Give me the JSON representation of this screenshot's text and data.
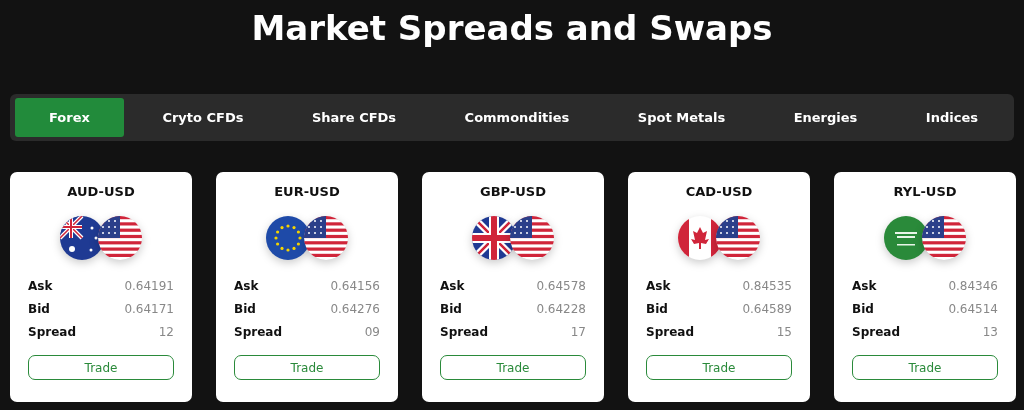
{
  "title": "Market Spreads and Swaps",
  "tabs": [
    {
      "label": "Forex",
      "selected": true
    },
    {
      "label": "Cryto CFDs",
      "selected": false
    },
    {
      "label": "Share CFDs",
      "selected": false
    },
    {
      "label": "Commondities",
      "selected": false
    },
    {
      "label": "Spot Metals",
      "selected": false
    },
    {
      "label": "Energies",
      "selected": false
    },
    {
      "label": "Indices",
      "selected": false
    }
  ],
  "cards": [
    {
      "pair": "AUD-USD",
      "rows": [
        {
          "label": "Ask",
          "value": "0.64191"
        },
        {
          "label": "Bid",
          "value": "0.64171"
        },
        {
          "label": "Spread",
          "value": "12"
        }
      ],
      "button": "Trade"
    },
    {
      "pair": "EUR-USD",
      "rows": [
        {
          "label": "Ask",
          "value": "0.64156"
        },
        {
          "label": "Bid",
          "value": "0.64276"
        },
        {
          "label": "Spread",
          "value": "09"
        }
      ],
      "button": "Trade"
    },
    {
      "pair": "GBP-USD",
      "rows": [
        {
          "label": "Ask",
          "value": "0.64578"
        },
        {
          "label": "Bid",
          "value": "0.64228"
        },
        {
          "label": "Spread",
          "value": "17"
        }
      ],
      "button": "Trade"
    },
    {
      "pair": "CAD-USD",
      "rows": [
        {
          "label": "Ask",
          "value": "0.84535"
        },
        {
          "label": "Bid",
          "value": "0.64589"
        },
        {
          "label": "Spread",
          "value": "15"
        }
      ],
      "button": "Trade"
    },
    {
      "pair": "RYL-USD",
      "rows": [
        {
          "label": "Ask",
          "value": "0.84346"
        },
        {
          "label": "Bid",
          "value": "0.64514"
        },
        {
          "label": "Spread",
          "value": "13"
        }
      ],
      "button": "Trade"
    }
  ]
}
